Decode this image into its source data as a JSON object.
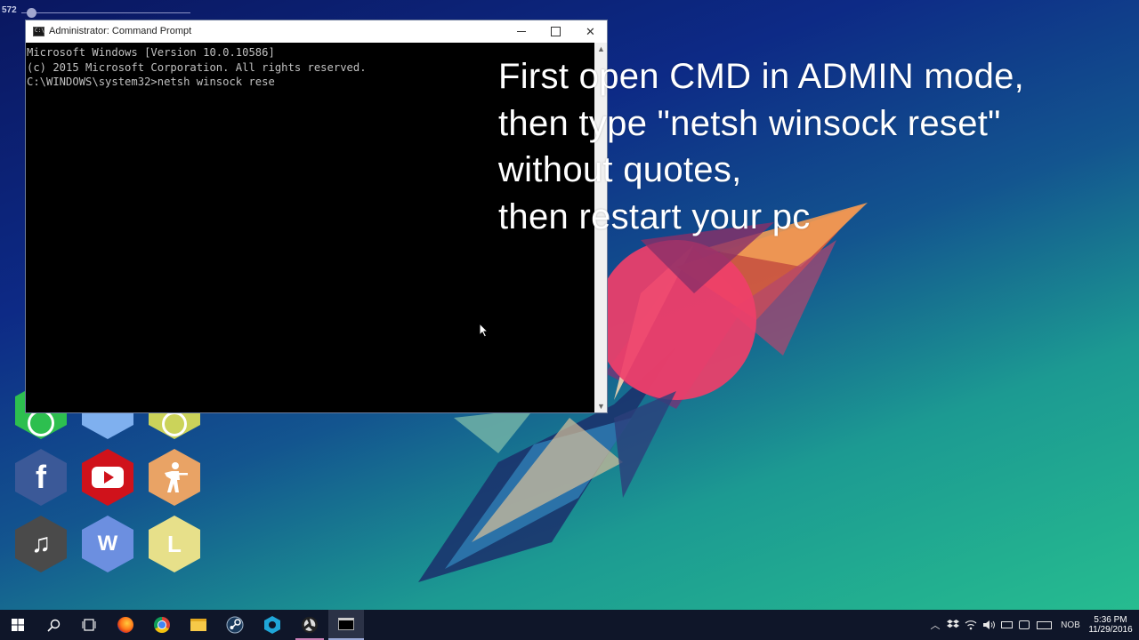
{
  "top_indicator": {
    "text": "572"
  },
  "cmd_window": {
    "title": "Administrator: Command Prompt",
    "console_lines": [
      "Microsoft Windows [Version 10.0.10586]",
      "(c) 2015 Microsoft Corporation. All rights reserved.",
      "",
      "C:\\WINDOWS\\system32>netsh winsock rese"
    ],
    "buttons": {
      "minimize": "—",
      "maximize": "☐",
      "close": "✕"
    }
  },
  "instructions": {
    "lines": [
      "First open CMD in ADMIN mode,",
      "then type \"netsh winsock reset\"",
      "without quotes,",
      "then restart your pc"
    ]
  },
  "desktop_icons": [
    {
      "name": "whatsapp",
      "color": "#2dbf4f"
    },
    {
      "name": "blue-app",
      "color": "#7fb0ef"
    },
    {
      "name": "chrome-gold",
      "color": "#cbd35a"
    },
    {
      "name": "facebook",
      "label": "f",
      "color": "#3b5998"
    },
    {
      "name": "youtube",
      "color": "#d0121b"
    },
    {
      "name": "counter-strike",
      "color": "#e9a365"
    },
    {
      "name": "music",
      "label": "♫",
      "color": "#4a4a4a"
    },
    {
      "name": "word",
      "label": "W",
      "color": "#6c8fe0"
    },
    {
      "name": "l-app",
      "label": "L",
      "color": "#e7e08a"
    }
  ],
  "taskbar": {
    "items": [
      "windows-start-icon",
      "search-icon",
      "task-view-icon",
      "firefox-icon",
      "chrome-icon",
      "file-explorer-icon",
      "steam-icon",
      "blue-hex-app-icon",
      "obs-icon",
      "command-prompt-icon"
    ],
    "tray": {
      "language": "NOB",
      "time": "5:36 PM",
      "date": "11/29/2016"
    }
  }
}
